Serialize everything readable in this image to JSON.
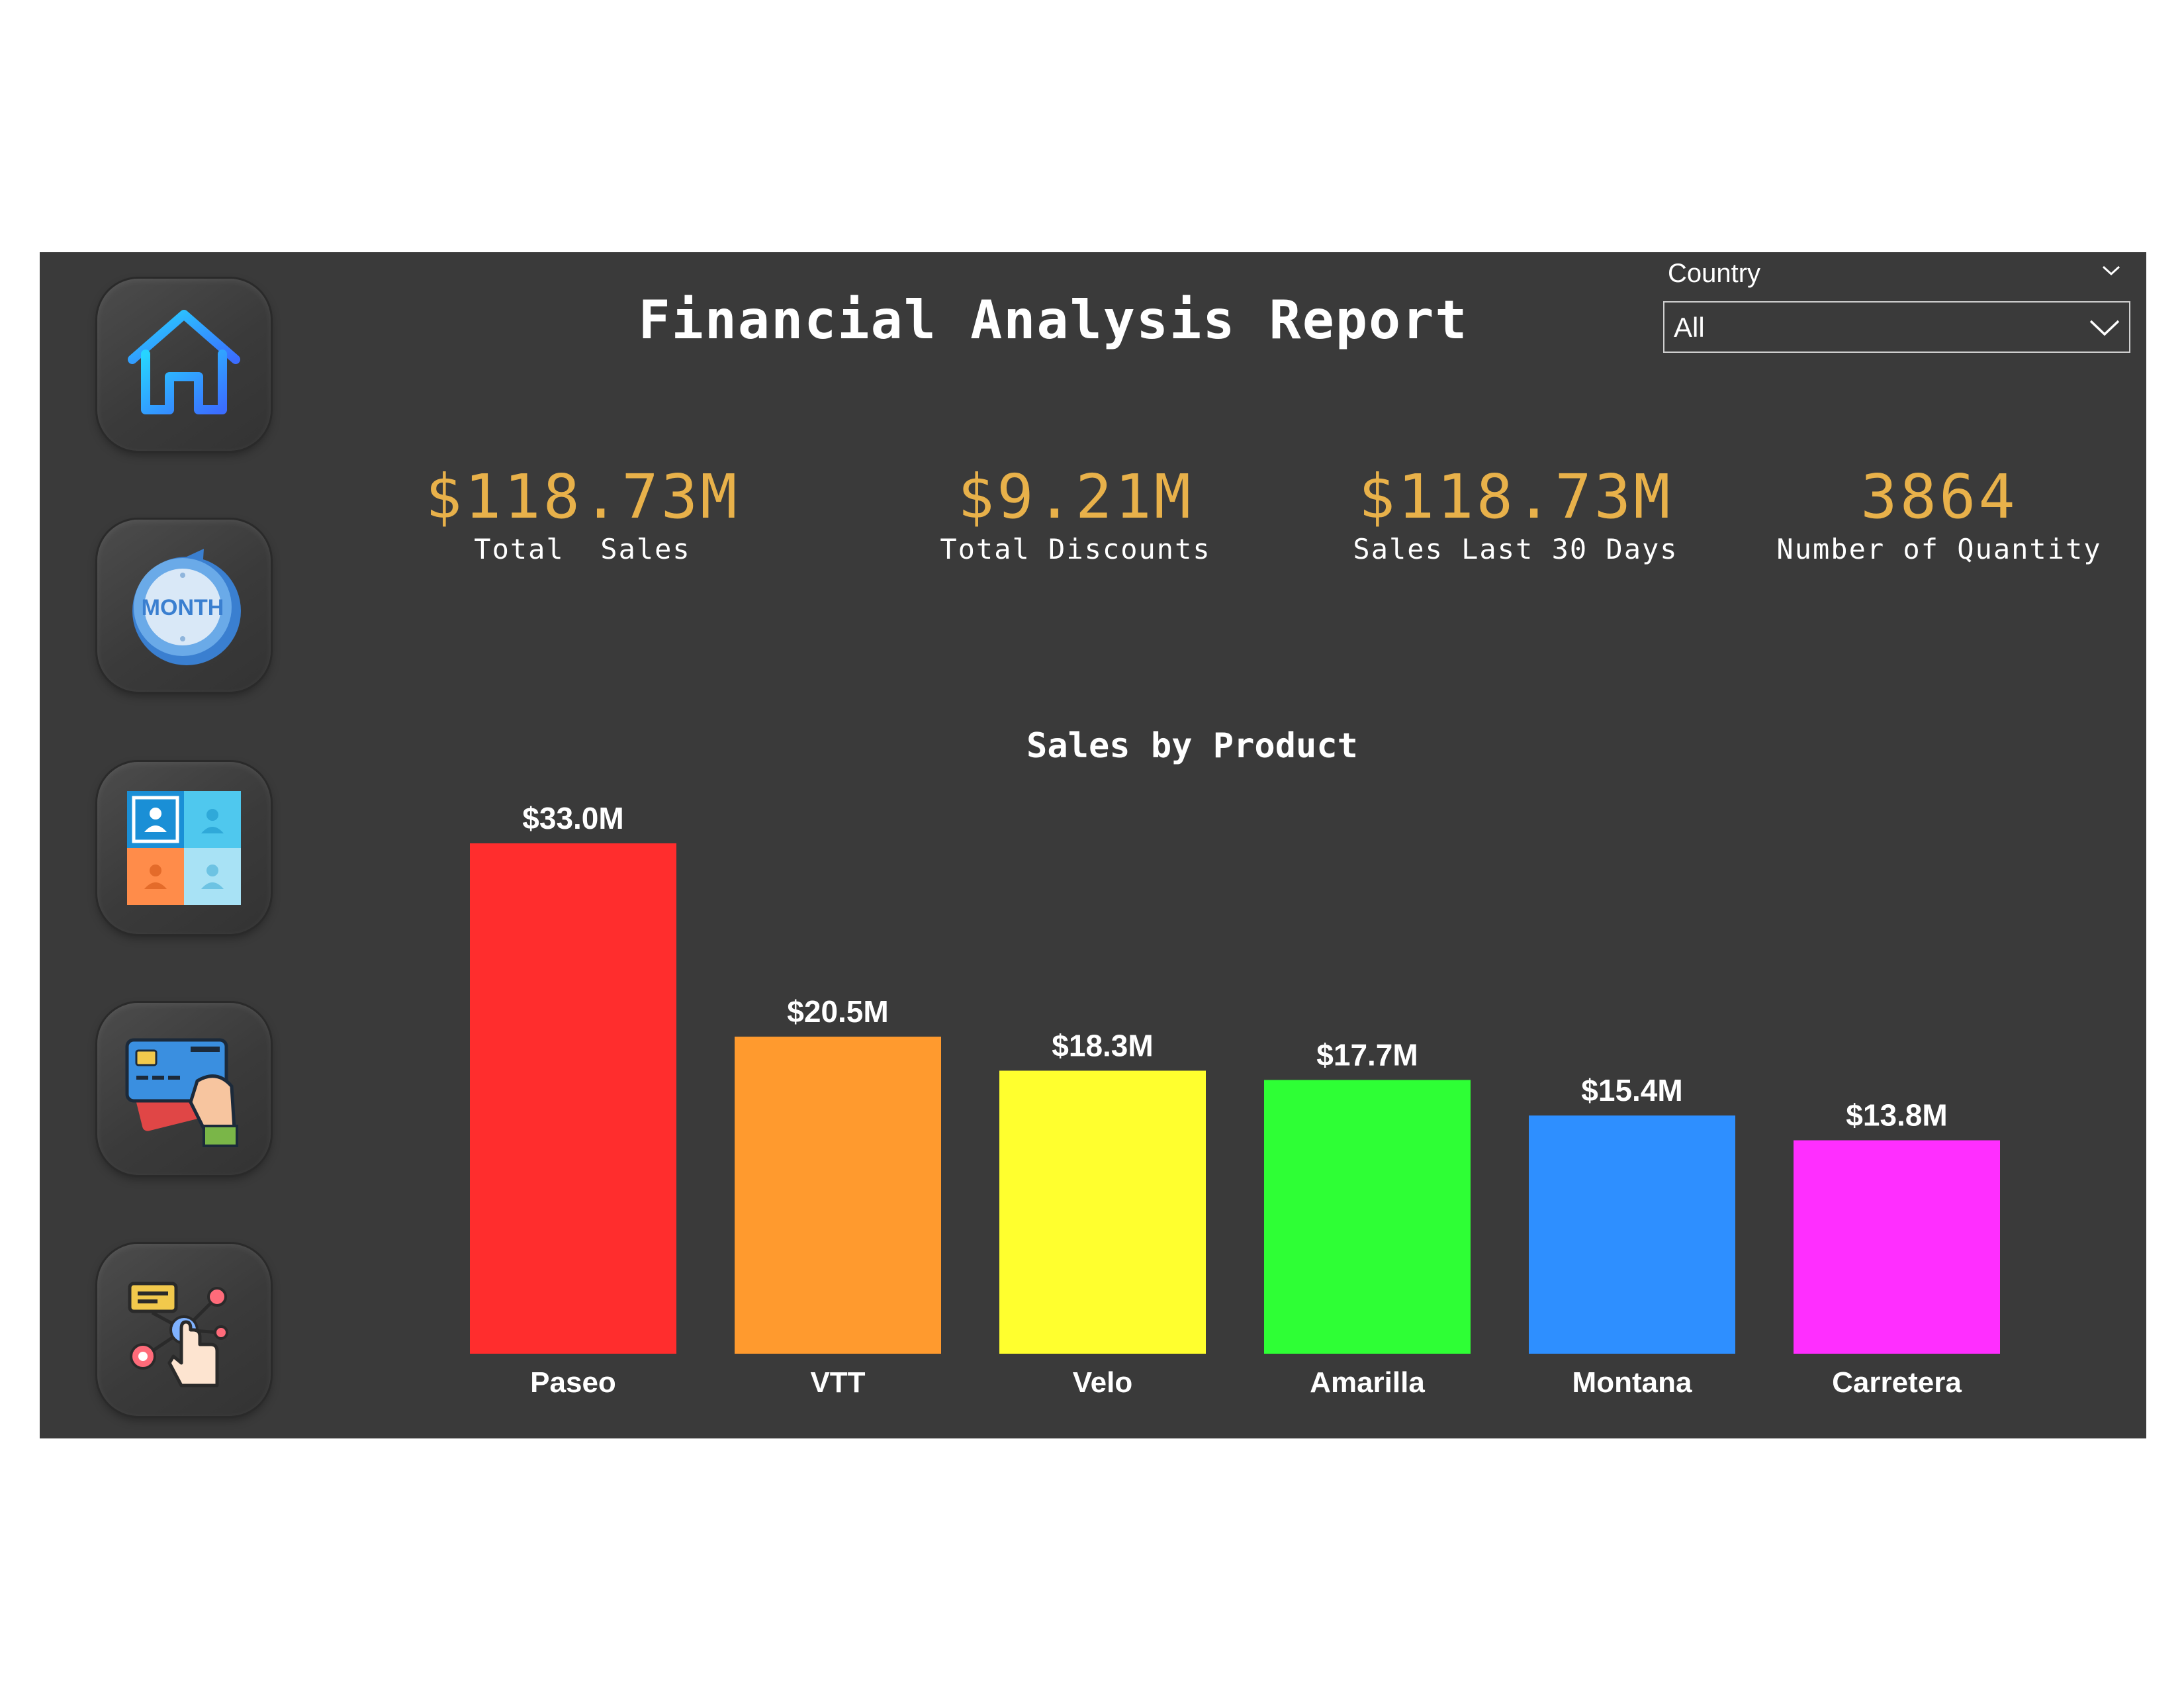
{
  "header": {
    "title": "Financial Analysis Report"
  },
  "filter": {
    "label": "Country",
    "value": "All"
  },
  "nav": [
    {
      "name": "home",
      "icon": "home-icon"
    },
    {
      "name": "month",
      "icon": "month-calendar-icon",
      "text": "MONTH"
    },
    {
      "name": "customers",
      "icon": "customers-grid-icon"
    },
    {
      "name": "payment",
      "icon": "credit-card-payment-icon"
    },
    {
      "name": "interaction",
      "icon": "touch-network-icon"
    }
  ],
  "kpis": [
    {
      "value": "$118.73M",
      "label": "Total  Sales"
    },
    {
      "value": "$9.21M",
      "label": "Total Discounts"
    },
    {
      "value": "$118.73M",
      "label": "Sales Last 30 Days"
    },
    {
      "value": "3864",
      "label": "Number of Quantity"
    }
  ],
  "colors": {
    "background": "#3a3a3a",
    "kpi_value": "#e8b14a",
    "bars": [
      "#ff2d2d",
      "#ff9a2e",
      "#ffff2e",
      "#2eff35",
      "#2e8fff",
      "#ff2eff"
    ]
  },
  "chart_data": {
    "type": "bar",
    "title": "Sales by Product",
    "categories": [
      "Paseo",
      "VTT",
      "Velo",
      "Amarilla",
      "Montana",
      "Carretera"
    ],
    "values": [
      33.0,
      20.5,
      18.3,
      17.7,
      15.4,
      13.8
    ],
    "data_labels": [
      "$33.0M",
      "$20.5M",
      "$18.3M",
      "$17.7M",
      "$15.4M",
      "$13.8M"
    ],
    "ylim": [
      0,
      33.0
    ],
    "xlabel": "",
    "ylabel": "",
    "grid": false
  }
}
